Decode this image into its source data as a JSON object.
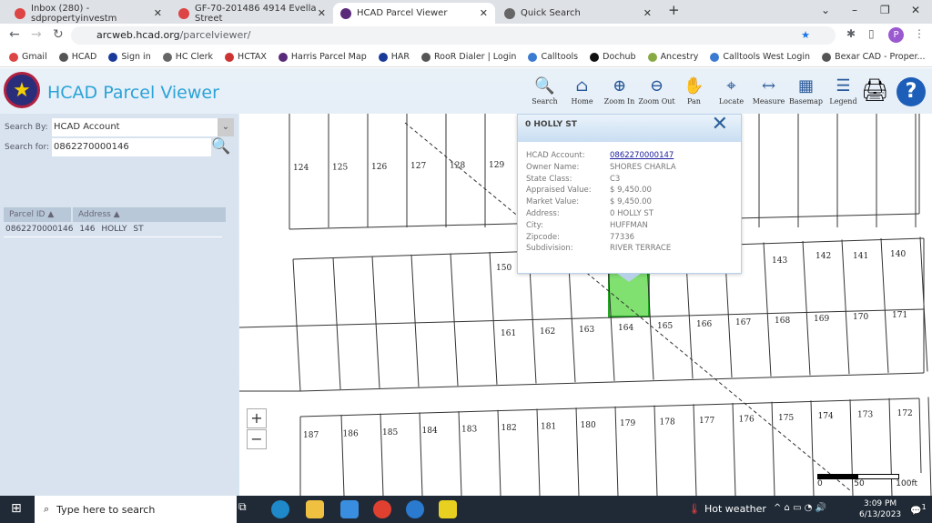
{
  "browser": {
    "tabs": [
      {
        "label": "Inbox (280) - sdpropertyinvestm",
        "icon": "gmail-icon"
      },
      {
        "label": "GF-70-201486 4914 Evella Street",
        "icon": "gmail-icon"
      },
      {
        "label": "HCAD Parcel Viewer",
        "icon": "hcad-icon",
        "active": true
      },
      {
        "label": "Quick Search",
        "icon": "globe-icon"
      }
    ],
    "url_host": "arcweb.hcad.org",
    "url_path": "/parcelviewer/",
    "profile": "P",
    "bookmarks": [
      "Gmail",
      "HCAD",
      "Sign in",
      "HC Clerk",
      "HCTAX",
      "Harris Parcel Map",
      "HAR",
      "RooR Dialer | Login",
      "Calltools",
      "Dochub",
      "Ancestry",
      "Calltools West Login",
      "Bexar CAD - Proper..."
    ]
  },
  "app": {
    "title": "HCAD Parcel Viewer",
    "tools": [
      "Search",
      "Home",
      "Zoom In",
      "Zoom Out",
      "Pan",
      "Locate",
      "Measure",
      "Basemap",
      "Legend"
    ],
    "tool_icons": [
      "🔍",
      "⌂",
      "⊕",
      "⊖",
      "✋",
      "⌖",
      "↔",
      "▦",
      "☰"
    ],
    "search_by_label": "Search By:",
    "search_by_value": "HCAD Account",
    "search_for_label": "Search for:",
    "search_for_value": "0862270000146",
    "results_headers": [
      "Parcel ID ▲",
      "Address ▲"
    ],
    "results": [
      {
        "id": "0862270000146",
        "address": "146 HOLLY ST"
      }
    ]
  },
  "popup": {
    "title": "0 HOLLY ST",
    "rows": [
      {
        "k": "HCAD Account:",
        "v": "0862270000147"
      },
      {
        "k": "Owner Name:",
        "v": "SHORES CHARLA"
      },
      {
        "k": "State Class:",
        "v": "C3"
      },
      {
        "k": "Appraised Value:",
        "v": "$ 9,450.00"
      },
      {
        "k": "Market Value:",
        "v": "$ 9,450.00"
      },
      {
        "k": "Address:",
        "v": "0 HOLLY ST"
      },
      {
        "k": "City:",
        "v": "HUFFMAN"
      },
      {
        "k": "Zipcode:",
        "v": "77336"
      },
      {
        "k": "Subdivision:",
        "v": "RIVER TERRACE"
      }
    ]
  },
  "map": {
    "lots_top": [
      "124",
      "125",
      "126",
      "127",
      "128",
      "129"
    ],
    "lots_mid_upper": [
      "150",
      "143",
      "142",
      "141",
      "140"
    ],
    "lots_mid_lower": [
      "161",
      "162",
      "163",
      "164",
      "165",
      "166",
      "167",
      "168",
      "169",
      "170",
      "171"
    ],
    "lots_bottom": [
      "187",
      "186",
      "185",
      "184",
      "183",
      "182",
      "181",
      "180",
      "179",
      "178",
      "177",
      "176",
      "175",
      "174",
      "173",
      "172"
    ],
    "selected_color": "#80e070",
    "zoom_in": "+",
    "zoom_out": "−",
    "scale_labels": [
      "0",
      "50",
      "100ft"
    ]
  },
  "taskbar": {
    "search_placeholder": "Type here to search",
    "weather": "Hot weather",
    "time": "3:09 PM",
    "date": "6/13/2023",
    "notifications": "1"
  }
}
